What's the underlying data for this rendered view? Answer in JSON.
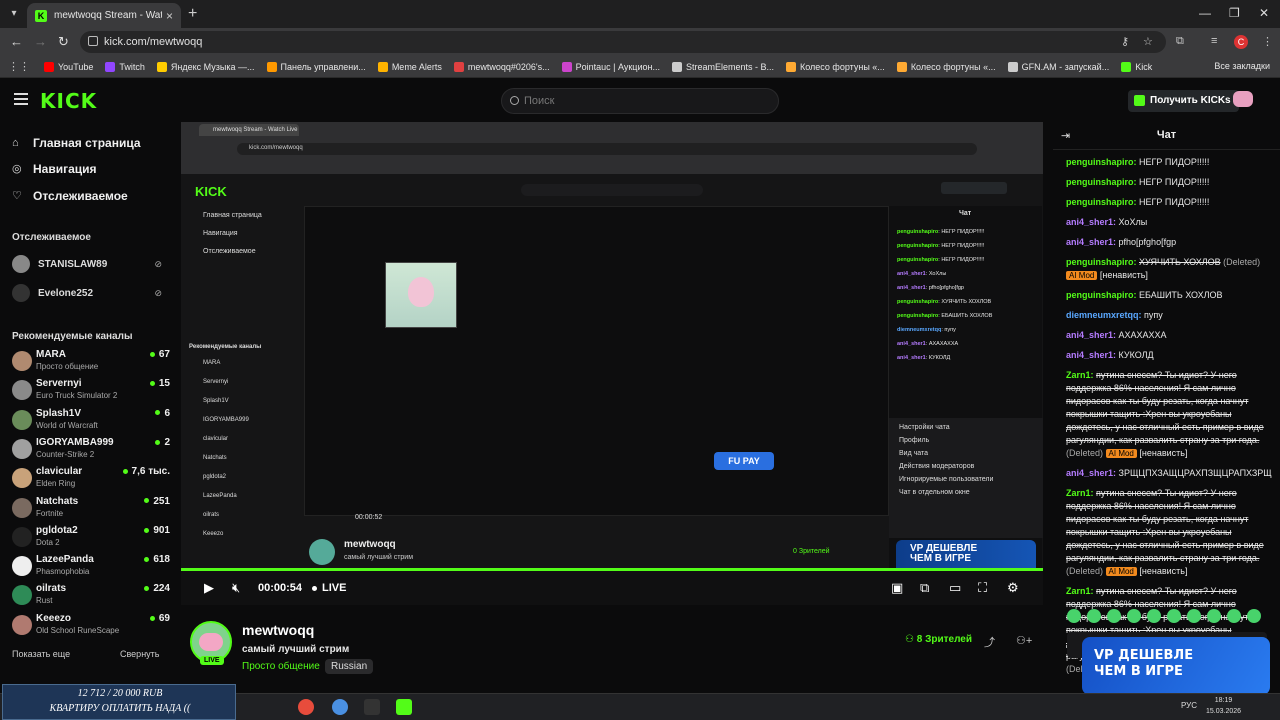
{
  "browser": {
    "tab_title": "mewtwoqq Stream - Watch Live",
    "url": "kick.com/mewtwoqq",
    "profile_initial": "C",
    "bookmarks": [
      {
        "label": "YouTube",
        "color": "#ff0000"
      },
      {
        "label": "Twitch",
        "color": "#9146ff"
      },
      {
        "label": "Яндекс Музыка —...",
        "color": "#ffcc00"
      },
      {
        "label": "Панель управлени...",
        "color": "#ff9900"
      },
      {
        "label": "Meme Alerts",
        "color": "#ffb300"
      },
      {
        "label": "mewtwoqq#0206's...",
        "color": "#e04040"
      },
      {
        "label": "Pointauc | Аукцион...",
        "color": "#cc44cc"
      },
      {
        "label": "StreamElements - В...",
        "color": "#cccccc"
      },
      {
        "label": "Колесо фортуны «...",
        "color": "#ffaa33"
      },
      {
        "label": "Колесо фортуны «...",
        "color": "#ffaa33"
      },
      {
        "label": "GFN.AM - запускай...",
        "color": "#cccccc"
      },
      {
        "label": "Kick",
        "color": "#53fc18"
      }
    ],
    "all_bookmarks": "Все закладки"
  },
  "header": {
    "logo": "KICK",
    "search_placeholder": "Поиск",
    "get_kicks": "Получить KICKs"
  },
  "sidebar": {
    "nav": [
      {
        "label": "Главная страница",
        "icon": "home-icon"
      },
      {
        "label": "Навигация",
        "icon": "compass-icon"
      },
      {
        "label": "Отслеживаемое",
        "icon": "heart-icon"
      }
    ],
    "following_title": "Отслеживаемое",
    "following": [
      {
        "name": "STANISLAW89"
      },
      {
        "name": "Evelone252"
      }
    ],
    "recommended_title": "Рекомендуемые каналы",
    "channels": [
      {
        "name": "MARA",
        "game": "Просто общение",
        "viewers": "67",
        "color": "#b08a70"
      },
      {
        "name": "Servernyi",
        "game": "Euro Truck Simulator 2",
        "viewers": "15",
        "color": "#8a8a8a"
      },
      {
        "name": "Splash1V",
        "game": "World of Warcraft",
        "viewers": "6",
        "color": "#6a8c5a"
      },
      {
        "name": "IGORYAMBA999",
        "game": "Counter-Strike 2",
        "viewers": "2",
        "color": "#a0a0a0"
      },
      {
        "name": "clavicular",
        "game": "Elden Ring",
        "viewers": "7,6 тыс.",
        "color": "#c8a27a"
      },
      {
        "name": "Natchats",
        "game": "Fortnite",
        "viewers": "251",
        "color": "#7a6a60"
      },
      {
        "name": "pgldota2",
        "game": "Dota 2",
        "viewers": "901",
        "color": "#222222"
      },
      {
        "name": "LazeePanda",
        "game": "Phasmophobia",
        "viewers": "618",
        "color": "#eeeeee"
      },
      {
        "name": "oilrats",
        "game": "Rust",
        "viewers": "224",
        "color": "#2e8b57"
      },
      {
        "name": "Keeezo",
        "game": "Old School RuneScape",
        "viewers": "69",
        "color": "#b07a70"
      }
    ],
    "show_more": "Показать еще",
    "collapse": "Свернуть"
  },
  "player": {
    "time": "00:00:54",
    "live_label": "LIVE",
    "inner_channel": "mewtwoqq",
    "inner_title": "самый лучший стрим",
    "inner_viewers": "0 Зрителей",
    "inner_time": "00:00:52",
    "fupay": "FU PAY",
    "chat_settings": [
      "Настройки чата",
      "Профиль",
      "Вид чата",
      "Действия модераторов",
      "Игнорируемые пользователи",
      "Чат в отдельном окне"
    ]
  },
  "stream": {
    "channel": "mewtwoqq",
    "live_badge": "LIVE",
    "title": "самый лучший стрим",
    "category": "Просто общение",
    "language": "Russian",
    "viewers_count": "8",
    "viewers_label": "Зрителей"
  },
  "chat": {
    "title": "Чат",
    "messages": [
      {
        "user": "penguinshapiro",
        "color": "#53fc18",
        "text": "НЕГР ПИДОР!!!!!"
      },
      {
        "user": "penguinshapiro",
        "color": "#53fc18",
        "text": "НЕГР ПИДОР!!!!!"
      },
      {
        "user": "penguinshapiro",
        "color": "#53fc18",
        "text": "НЕГР ПИДОР!!!!!"
      },
      {
        "user": "ani4_sher1",
        "color": "#b57cff",
        "text": "ХоХлы"
      },
      {
        "user": "ani4_sher1",
        "color": "#b57cff",
        "text": "pfho[pfgho[fgp"
      },
      {
        "user": "penguinshapiro",
        "color": "#53fc18",
        "text": "ХУЯЧИТЬ ХОХЛОВ",
        "deleted": "(Deleted)",
        "mod": "AI Mod",
        "tag": "[ненависть]"
      },
      {
        "user": "penguinshapiro",
        "color": "#53fc18",
        "text": "ЕБАШИТЬ ХОХЛОВ"
      },
      {
        "user": "diemneumxretqq",
        "color": "#5aa8ff",
        "text": "пупу"
      },
      {
        "user": "ani4_sher1",
        "color": "#b57cff",
        "text": "АХАХАХХА"
      },
      {
        "user": "ani4_sher1",
        "color": "#b57cff",
        "text": "КУКОЛД"
      },
      {
        "user": "Zarn1",
        "color": "#53fc18",
        "text": "путина снесем? Ты идиот? У него поддержка 86% населения! Я сам лично пидорасов как ты буду резать, когда начнут покрышки тащить :Хрен вы укроуебаны дождетесь, у нас отличный есть пример в виде рагуляндии, как развалить страну за три года.",
        "deleted": "(Deleted)",
        "mod": "AI Mod",
        "tag": "[ненависть]"
      },
      {
        "user": "ani4_sher1",
        "color": "#b57cff",
        "text": "ЗРЩЦПХЗАЩЦРАХПЗЩЦРАПХЗРЩ"
      },
      {
        "user": "Zarn1",
        "color": "#53fc18",
        "text": "путина снесем? Ты идиот? У него поддержка 86% населения! Я сам лично пидорасов как ты буду резать, когда начнут покрышки тащить :Хрен вы укроуебаны дождетесь, у нас отличный есть пример в виде рагуляндии, как развалить страну за три года.",
        "deleted": "(Deleted)",
        "mod": "AI Mod",
        "tag": "[ненависть]"
      },
      {
        "user": "Zarn1",
        "color": "#53fc18",
        "text": "путина снесем? Ты идиот? У него поддержка 86% населения! Я сам лично пидорасов как ты буду резать, когда начнут покрышки тащить :Хрен вы укроуебаны дождетесь, у нас отличный есть пример в виде рагуляндии, как развалить страну за три года.",
        "deleted": "(Deleted)",
        "mod": "AI Mod",
        "tag": "[ненависть]"
      }
    ]
  },
  "ad": {
    "line1": "VP ДЕШЕВЛЕ",
    "line2": "ЧЕМ В ИГРЕ"
  },
  "donation": {
    "amount": "12 712 / 20 000 RUB",
    "text": "КВАРТИРУ ОПЛАТИТЬ НАДА (("
  },
  "taskbar": {
    "lang": "РУС",
    "time": "18:19",
    "date": "15.03.2026"
  }
}
